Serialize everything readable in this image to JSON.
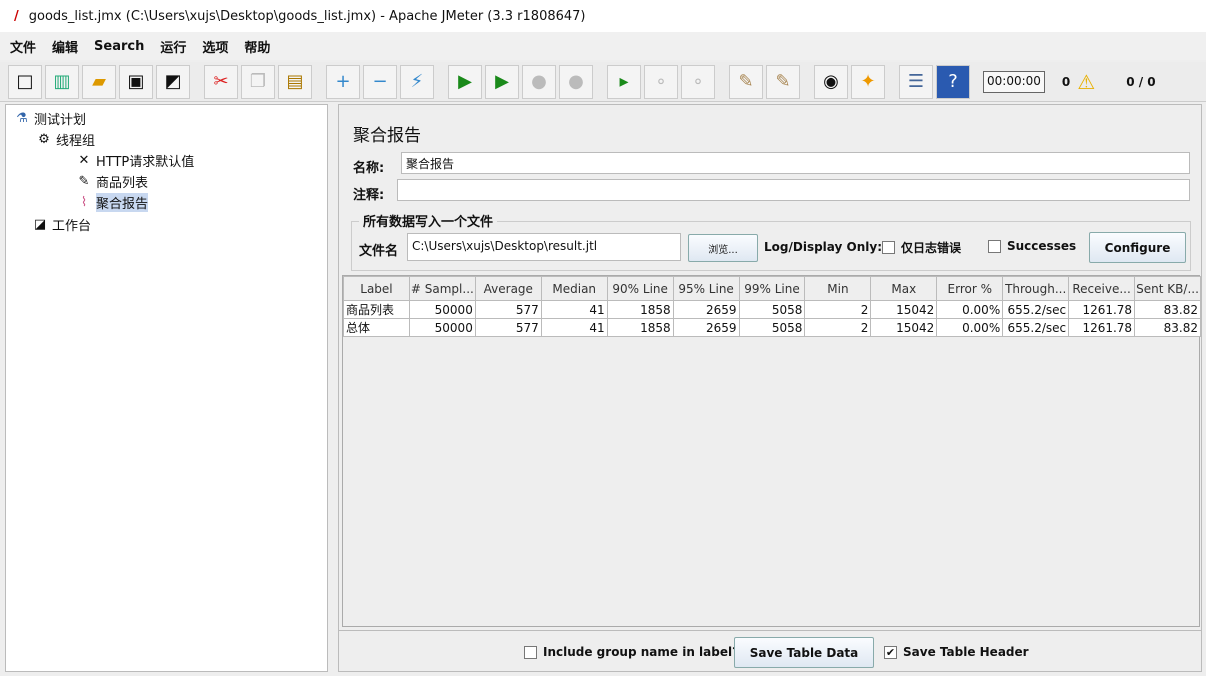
{
  "window": {
    "title": "goods_list.jmx (C:\\Users\\xujs\\Desktop\\goods_list.jmx) - Apache JMeter (3.3 r1808647)"
  },
  "menu": [
    "文件",
    "编辑",
    "Search",
    "运行",
    "选项",
    "帮助"
  ],
  "toolbar": {
    "icons": [
      "new-icon",
      "templates-icon",
      "open-icon",
      "save-icon",
      "save-as-icon",
      "cut-icon",
      "copy-icon",
      "paste-icon",
      "expand-icon",
      "collapse-icon",
      "toggle-icon",
      "start-icon",
      "start-no-pause-icon",
      "stop-icon",
      "shutdown-icon",
      "remote-start-icon",
      "remote-stop-icon",
      "remote-shutdown-icon",
      "clear-icon",
      "clear-all-icon",
      "search-icon",
      "reset-search-icon",
      "function-helper-icon",
      "help-icon"
    ],
    "timer": "00:00:00",
    "warnings": "0",
    "threads": "0 / 0"
  },
  "tree": {
    "test_plan": "测试计划",
    "thread_group": "线程组",
    "http_defaults": "HTTP请求默认值",
    "goods_list": "商品列表",
    "aggregate": "聚合报告",
    "workbench": "工作台"
  },
  "panel": {
    "title": "聚合报告",
    "name_label": "名称:",
    "name_value": "聚合报告",
    "comment_label": "注释:",
    "comment_value": "",
    "file_group": "所有数据写入一个文件",
    "file_label": "文件名",
    "file_value": "C:\\Users\\xujs\\Desktop\\result.jtl",
    "browse": "浏览...",
    "log_only": "Log/Display Only:",
    "errors_only": "仅日志错误",
    "successes": "Successes",
    "configure": "Configure"
  },
  "table": {
    "headers": [
      "Label",
      "# Sampl...",
      "Average",
      "Median",
      "90% Line",
      "95% Line",
      "99% Line",
      "Min",
      "Max",
      "Error %",
      "Through...",
      "Receive...",
      "Sent KB/..."
    ],
    "rows": [
      [
        "商品列表",
        "50000",
        "577",
        "41",
        "1858",
        "2659",
        "5058",
        "2",
        "15042",
        "0.00%",
        "655.2/sec",
        "1261.78",
        "83.82"
      ],
      [
        "总体",
        "50000",
        "577",
        "41",
        "1858",
        "2659",
        "5058",
        "2",
        "15042",
        "0.00%",
        "655.2/sec",
        "1261.78",
        "83.82"
      ]
    ]
  },
  "footer": {
    "include_group": "Include group name in label?",
    "include_group_checked": false,
    "save_data": "Save Table Data",
    "save_header": "Save Table Header",
    "save_header_checked": true
  }
}
